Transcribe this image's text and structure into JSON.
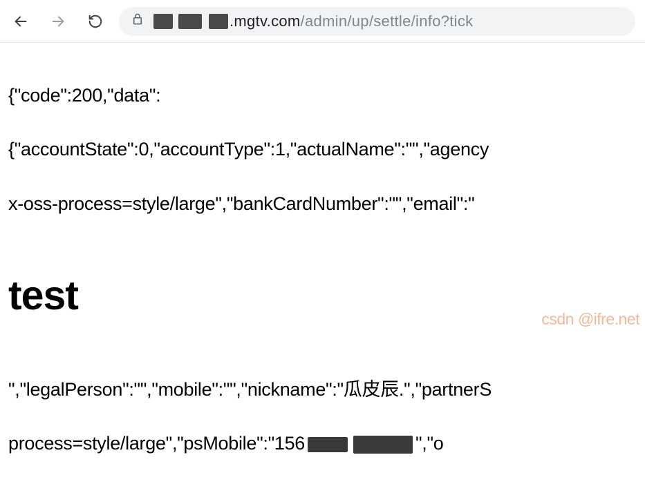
{
  "toolbar": {
    "url_domain": ".mgtv.com",
    "url_path": "/admin/up/settle/info?tick"
  },
  "content": {
    "line1": "{\"code\":200,\"data\":",
    "line2": "{\"accountState\":0,\"accountType\":1,\"actualName\":\"\",\"agency",
    "line3": "x-oss-process=style/large\",\"bankCardNumber\":\"\",\"email\":\"",
    "heading": "test",
    "line4_a": "\",\"legalPerson\":\"\",\"mobile\":\"\",\"nickname\":\"瓜皮辰.\",\"partnerS",
    "line5_a": "process=style/large\",\"psMobile\":\"156",
    "line5_b": "\",\"o"
  },
  "watermark": "csdn @ifre.net"
}
